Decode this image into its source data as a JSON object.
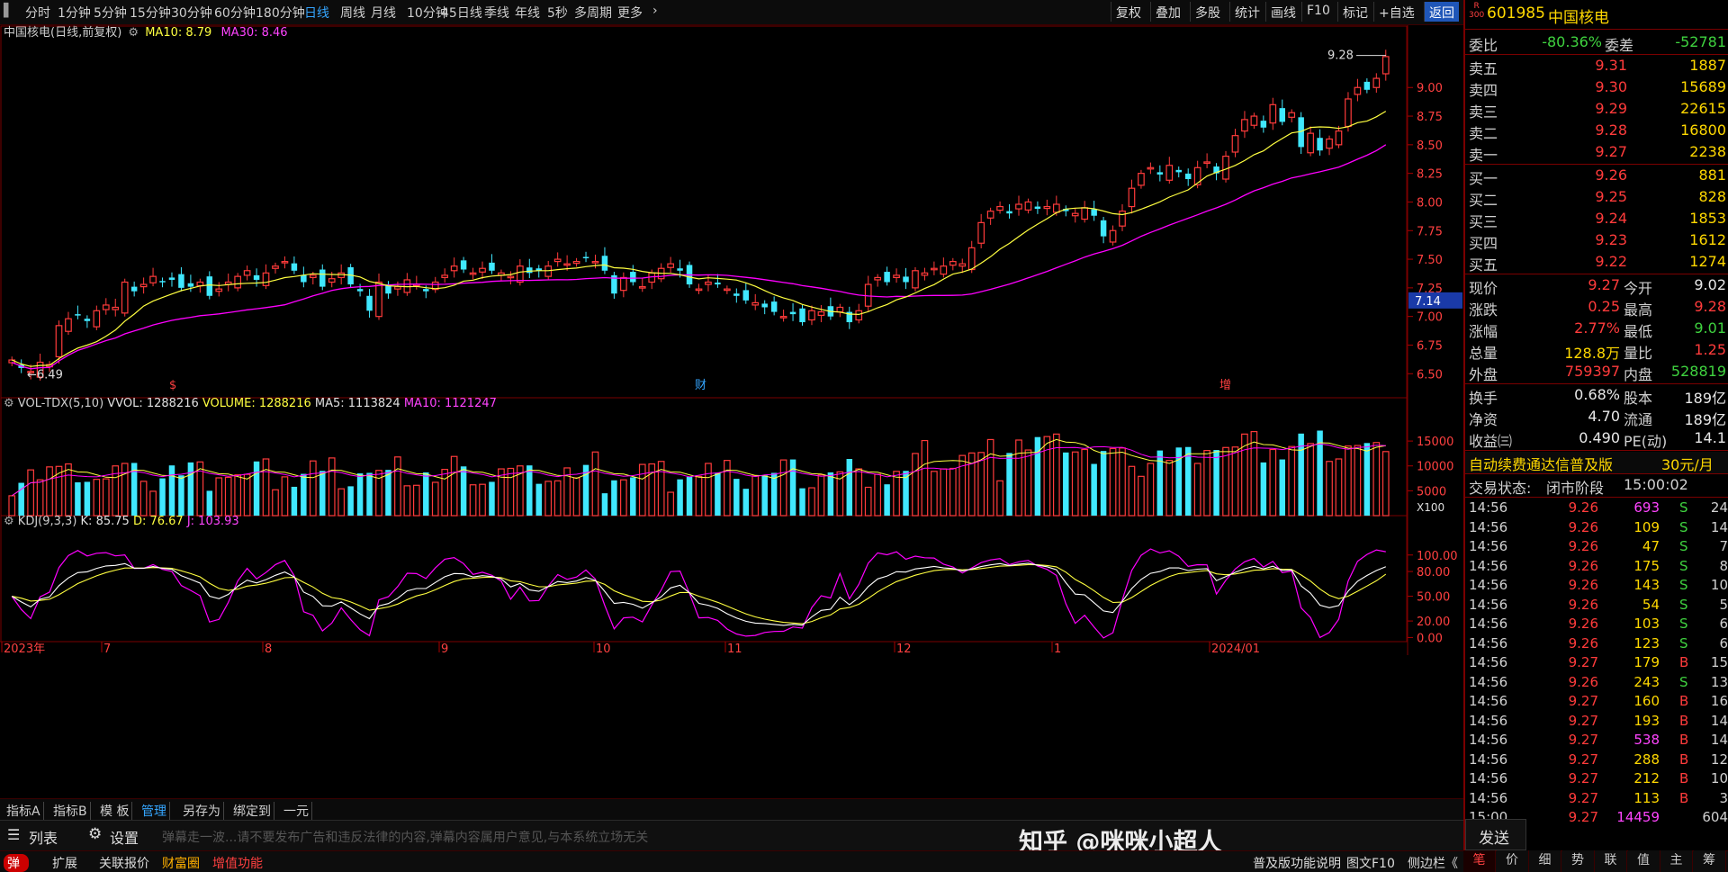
{
  "periods": [
    "分时",
    "1分钟",
    "5分钟",
    "15分钟",
    "30分钟",
    "60分钟",
    "180分钟",
    "日线",
    "周线",
    "月线",
    "10分钟",
    "45日线",
    "季线",
    "年线",
    "5秒",
    "多周期",
    "更多"
  ],
  "active_period": "日线",
  "toolbar_right": [
    "复权",
    "叠加",
    "多股",
    "统计",
    "画线",
    "F10",
    "标记",
    "+自选",
    "返回"
  ],
  "main_title": {
    "name": "中国核电(日线,前复权)",
    "ma10_label": "MA10: 8.79",
    "ma30_label": "MA30: 8.46"
  },
  "vol_title": {
    "name": "VOL-TDX(5,10)",
    "vvol": "VVOL: 1288216",
    "volume": "VOLUME: 1288216",
    "ma5": "MA5: 1113824",
    "ma10": "MA10: 1121247"
  },
  "kdj_title": {
    "name": "KDJ(9,3,3)",
    "k": "K: 85.75",
    "d": "D: 76.67",
    "j": "J: 103.93"
  },
  "price_axis": [
    "9.00",
    "8.75",
    "8.50",
    "8.25",
    "8.00",
    "7.75",
    "7.50",
    "7.25",
    "7.00",
    "6.75",
    "6.50"
  ],
  "price_current_tag": "7.14",
  "vol_axis": [
    "15000",
    "10000",
    "5000"
  ],
  "vol_unit": "X100",
  "kdj_axis": [
    "100.00",
    "80.00",
    "50.00",
    "20.00",
    "0.00"
  ],
  "date_axis": [
    "2023年",
    "7",
    "8",
    "9",
    "10",
    "11",
    "12",
    "1",
    "2024/01"
  ],
  "annotations": {
    "high": "9.28",
    "low": "6.49",
    "events": [
      "$",
      "财",
      "增"
    ]
  },
  "chart_data": {
    "type": "candlestick",
    "price_range": [
      6.4,
      9.45
    ],
    "closes": [
      6.62,
      6.55,
      6.52,
      6.6,
      6.58,
      6.92,
      6.98,
      7.02,
      6.96,
      7.05,
      7.1,
      7.08,
      7.3,
      7.22,
      7.28,
      7.35,
      7.3,
      7.32,
      7.25,
      7.26,
      7.3,
      7.18,
      7.24,
      7.3,
      7.35,
      7.4,
      7.32,
      7.38,
      7.44,
      7.48,
      7.4,
      7.3,
      7.36,
      7.26,
      7.33,
      7.38,
      7.28,
      7.22,
      7.05,
      7.3,
      7.2,
      7.26,
      7.32,
      7.28,
      7.22,
      7.3,
      7.36,
      7.44,
      7.41,
      7.38,
      7.42,
      7.4,
      7.38,
      7.35,
      7.44,
      7.38,
      7.4,
      7.44,
      7.5,
      7.46,
      7.48,
      7.52,
      7.48,
      7.4,
      7.2,
      7.34,
      7.3,
      7.26,
      7.38,
      7.42,
      7.46,
      7.4,
      7.28,
      7.24,
      7.3,
      7.28,
      7.24,
      7.18,
      7.14,
      7.12,
      7.08,
      7.04,
      7.0,
      7.02,
      6.95,
      7.05,
      7.04,
      7.0,
      7.08,
      6.95,
      7.05,
      7.28,
      7.34,
      7.3,
      7.36,
      7.3,
      7.4,
      7.38,
      7.42,
      7.44,
      7.48,
      7.46,
      7.6,
      7.82,
      7.92,
      7.96,
      7.9,
      7.98,
      8.0,
      7.94,
      7.96,
      7.98,
      7.92,
      7.9,
      7.95,
      7.88,
      7.7,
      7.75,
      7.92,
      8.12,
      8.25,
      8.3,
      8.24,
      8.32,
      8.26,
      8.2,
      8.3,
      8.35,
      8.25,
      8.4,
      8.58,
      8.72,
      8.75,
      8.65,
      8.85,
      8.7,
      8.78,
      8.48,
      8.6,
      8.45,
      8.55,
      8.62,
      8.9,
      9.0,
      8.98,
      9.08,
      9.27
    ],
    "ma10_last": 8.79,
    "ma30_last": 8.46,
    "vol_last": 12882,
    "vol_ma5_last": 11138,
    "vol_ma10_last": 11212,
    "kdj_last": {
      "k": 85.75,
      "d": 76.67,
      "j": 103.93
    }
  },
  "quote": {
    "code": "601985",
    "name": "中国核电",
    "badge_top": "R",
    "badge_bottom": "300",
    "weibi_label": "委比",
    "weibi": "-80.36%",
    "weicha_label": "委差",
    "weicha": "-52781",
    "asks": [
      {
        "label": "卖五",
        "price": "9.31",
        "vol": "1887"
      },
      {
        "label": "卖四",
        "price": "9.30",
        "vol": "15689"
      },
      {
        "label": "卖三",
        "price": "9.29",
        "vol": "22615"
      },
      {
        "label": "卖二",
        "price": "9.28",
        "vol": "16800"
      },
      {
        "label": "卖一",
        "price": "9.27",
        "vol": "2238"
      }
    ],
    "bids": [
      {
        "label": "买一",
        "price": "9.26",
        "vol": "881"
      },
      {
        "label": "买二",
        "price": "9.25",
        "vol": "828"
      },
      {
        "label": "买三",
        "price": "9.24",
        "vol": "1853"
      },
      {
        "label": "买四",
        "price": "9.23",
        "vol": "1612"
      },
      {
        "label": "买五",
        "price": "9.22",
        "vol": "1274"
      }
    ],
    "stats": [
      {
        "l1": "现价",
        "v1": "9.27",
        "c1": "red",
        "l2": "今开",
        "v2": "9.02",
        "c2": "white"
      },
      {
        "l1": "涨跌",
        "v1": "0.25",
        "c1": "red",
        "l2": "最高",
        "v2": "9.28",
        "c2": "red"
      },
      {
        "l1": "涨幅",
        "v1": "2.77%",
        "c1": "red",
        "l2": "最低",
        "v2": "9.01",
        "c2": "green"
      },
      {
        "l1": "总量",
        "v1": "128.8万",
        "c1": "yellow",
        "l2": "量比",
        "v2": "1.25",
        "c2": "red"
      },
      {
        "l1": "外盘",
        "v1": "759397",
        "c1": "red",
        "l2": "内盘",
        "v2": "528819",
        "c2": "green"
      }
    ],
    "stats2": [
      {
        "l1": "换手",
        "v1": "0.68%",
        "l2": "股本",
        "v2": "189亿"
      },
      {
        "l1": "净资",
        "v1": "4.70",
        "l2": "流通",
        "v2": "189亿"
      },
      {
        "l1": "收益㈢",
        "v1": "0.490",
        "l2": "PE(动)",
        "v2": "14.1"
      }
    ],
    "ad_text": "自动续费通达信普及版",
    "ad_price": "30元/月",
    "trade_state_label": "交易状态:",
    "trade_state": "闭市阶段",
    "trade_time": "15:00:02",
    "ticks": [
      {
        "t": "14:56",
        "p": "9.26",
        "pc": "red",
        "v": "693",
        "vc": "magenta",
        "s": "S",
        "n": "24"
      },
      {
        "t": "14:56",
        "p": "9.26",
        "pc": "red",
        "v": "109",
        "vc": "yellow",
        "s": "S",
        "n": "14"
      },
      {
        "t": "14:56",
        "p": "9.26",
        "pc": "red",
        "v": "47",
        "vc": "yellow",
        "s": "S",
        "n": "7"
      },
      {
        "t": "14:56",
        "p": "9.26",
        "pc": "red",
        "v": "175",
        "vc": "yellow",
        "s": "S",
        "n": "8"
      },
      {
        "t": "14:56",
        "p": "9.26",
        "pc": "red",
        "v": "143",
        "vc": "yellow",
        "s": "S",
        "n": "10"
      },
      {
        "t": "14:56",
        "p": "9.26",
        "pc": "red",
        "v": "54",
        "vc": "yellow",
        "s": "S",
        "n": "5"
      },
      {
        "t": "14:56",
        "p": "9.26",
        "pc": "red",
        "v": "103",
        "vc": "yellow",
        "s": "S",
        "n": "6"
      },
      {
        "t": "14:56",
        "p": "9.26",
        "pc": "red",
        "v": "123",
        "vc": "yellow",
        "s": "S",
        "n": "6"
      },
      {
        "t": "14:56",
        "p": "9.27",
        "pc": "red",
        "v": "179",
        "vc": "yellow",
        "s": "B",
        "n": "15"
      },
      {
        "t": "14:56",
        "p": "9.26",
        "pc": "red",
        "v": "243",
        "vc": "yellow",
        "s": "S",
        "n": "13"
      },
      {
        "t": "14:56",
        "p": "9.27",
        "pc": "red",
        "v": "160",
        "vc": "yellow",
        "s": "B",
        "n": "16"
      },
      {
        "t": "14:56",
        "p": "9.27",
        "pc": "red",
        "v": "193",
        "vc": "yellow",
        "s": "B",
        "n": "14"
      },
      {
        "t": "14:56",
        "p": "9.27",
        "pc": "red",
        "v": "538",
        "vc": "magenta",
        "s": "B",
        "n": "14"
      },
      {
        "t": "14:56",
        "p": "9.27",
        "pc": "red",
        "v": "288",
        "vc": "yellow",
        "s": "B",
        "n": "12"
      },
      {
        "t": "14:56",
        "p": "9.27",
        "pc": "red",
        "v": "212",
        "vc": "yellow",
        "s": "B",
        "n": "10"
      },
      {
        "t": "14:56",
        "p": "9.27",
        "pc": "red",
        "v": "113",
        "vc": "yellow",
        "s": "B",
        "n": "3"
      },
      {
        "t": "15:00",
        "p": "9.27",
        "pc": "red",
        "v": "14459",
        "vc": "magenta",
        "s": "",
        "n": "604"
      }
    ],
    "send_label": "发送",
    "bottom_tabs": [
      "笔",
      "价",
      "细",
      "势",
      "联",
      "值",
      "主",
      "筹"
    ]
  },
  "bottom_tabs": [
    "指标A",
    "指标B",
    "模 板",
    "管理",
    "另存为",
    "绑定到",
    "一元"
  ],
  "active_bottom_tab": "管理",
  "danmu": {
    "list_label": "列表",
    "settings_label": "设置",
    "placeholder": "弹幕走一波...请不要发布广告和违反法律的内容,弹幕内容属用户意见,与本系统立场无关"
  },
  "status_left": [
    "弹",
    "扩展",
    "关联报价",
    "财富圈",
    "增值功能"
  ],
  "status_right": [
    "普及版功能说明",
    "图文F10",
    "侧边栏《"
  ],
  "watermark": "知乎 @咪咪小超人",
  "colors": {
    "up": "#ff3b3b",
    "down": "#40e8ff",
    "ma10": "#ffff40",
    "ma30": "#ff00ff",
    "k": "#ffffff",
    "d": "#ffff40",
    "j": "#ff00ff",
    "frame": "#7a0000"
  }
}
